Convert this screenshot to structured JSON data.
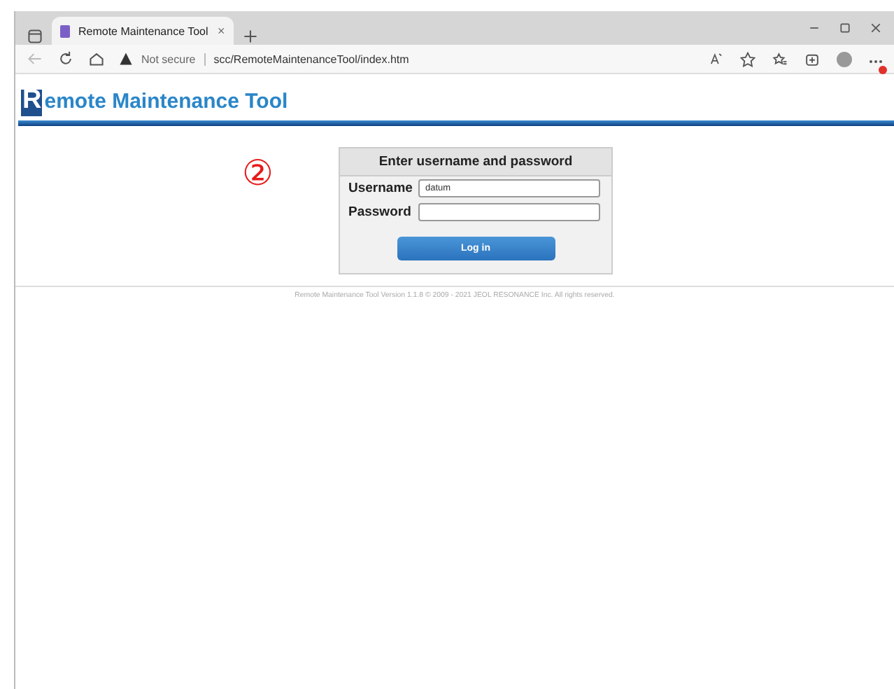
{
  "browser": {
    "tab_title": "Remote Maintenance Tool",
    "security": "Not secure",
    "url": "scc/RemoteMaintenanceTool/index.htm",
    "notification_badge": true
  },
  "page": {
    "logo": "Remote Maintenance Tool",
    "annotation": "②",
    "login": {
      "title": "Enter username and password",
      "fields": [
        {
          "label": "Username",
          "value": "datum"
        },
        {
          "label": "Password"
        }
      ],
      "button": "Log in"
    },
    "footer": "Remote Maintenance Tool Version 1.1.8 © 2009 - 2021 JEOL RESONANCE Inc. All rights reserved."
  }
}
